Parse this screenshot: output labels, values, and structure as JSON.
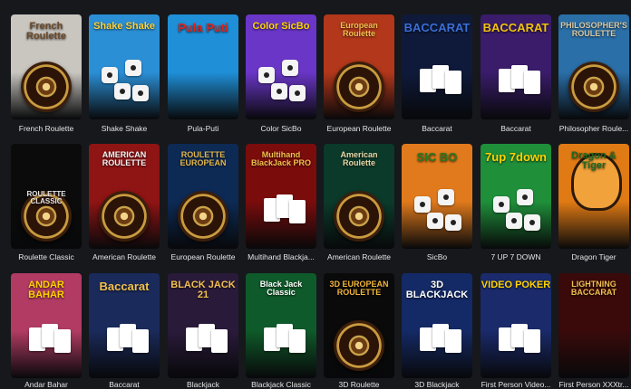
{
  "games": [
    {
      "id": "french-roulette",
      "title": "French Roulette",
      "art_text": "French Roulette",
      "bg": "#c9c6c0",
      "accent": "#6b4a2a"
    },
    {
      "id": "shake-shake",
      "title": "Shake Shake",
      "art_text": "Shake Shake",
      "bg": "#2b8fd6",
      "accent": "#ffd23a"
    },
    {
      "id": "pula-puti",
      "title": "Pula-Puti",
      "art_text": "Pula Puti",
      "bg": "#1f8fd8",
      "accent": "#e2231a"
    },
    {
      "id": "color-sicbo",
      "title": "Color SicBo",
      "art_text": "Color SicBo",
      "bg": "#6a36c8",
      "accent": "#ffd400"
    },
    {
      "id": "european-roulette-1",
      "title": "European Roulette",
      "art_text": "European Roulette",
      "bg": "#b2371b",
      "accent": "#f2c14e"
    },
    {
      "id": "baccarat-1",
      "title": "Baccarat",
      "art_text": "BACCARAT",
      "bg": "#0f1a3a",
      "accent": "#3a6fd8"
    },
    {
      "id": "baccarat-2",
      "title": "Baccarat",
      "art_text": "BACCARAT",
      "bg": "#3a1c6b",
      "accent": "#f1c40f"
    },
    {
      "id": "philosopher-roulette",
      "title": "Philosopher Roule...",
      "art_text": "PHILOSOPHER'S ROULETTE",
      "bg": "#2a6fa8",
      "accent": "#d9c9a3"
    },
    {
      "id": "roulette-classic",
      "title": "Roulette Classic",
      "art_text": "ROULETTE CLASSIC",
      "bg": "#0b0b0b",
      "accent": "#1f2a24"
    },
    {
      "id": "american-roulette-1",
      "title": "American Roulette",
      "art_text": "AMERICAN ROULETTE",
      "bg": "#8f1414",
      "accent": "#f5f5f5"
    },
    {
      "id": "european-roulette-2",
      "title": "European Roulette",
      "art_text": "ROULETTE EUROPEAN",
      "bg": "#0d2a55",
      "accent": "#e2b64a"
    },
    {
      "id": "multihand-blackjack",
      "title": "Multihand Blackja...",
      "art_text": "Multihand BlackJack PRO",
      "bg": "#7a0c0c",
      "accent": "#f2c14e"
    },
    {
      "id": "american-roulette-2",
      "title": "American Roulette",
      "art_text": "American Roulette",
      "bg": "#0b3a2a",
      "accent": "#e9d8a6"
    },
    {
      "id": "sicbo",
      "title": "SicBo",
      "art_text": "SIC BO",
      "bg": "#e07a1c",
      "accent": "#2b7a1f"
    },
    {
      "id": "7up-7down",
      "title": "7 UP 7 DOWN",
      "art_text": "7up 7down",
      "bg": "#1f8f3a",
      "accent": "#ffd400"
    },
    {
      "id": "dragon-tiger",
      "title": "Dragon Tiger",
      "art_text": "Dragon & Tiger",
      "bg": "#e07a14",
      "accent": "#1f6a1f"
    },
    {
      "id": "andar-bahar",
      "title": "Andar Bahar",
      "art_text": "ANDAR BAHAR",
      "bg": "#b13b63",
      "accent": "#ffd400"
    },
    {
      "id": "baccarat-3",
      "title": "Baccarat",
      "art_text": "Baccarat",
      "bg": "#1a2a5a",
      "accent": "#f2c14e"
    },
    {
      "id": "blackjack",
      "title": "Blackjack",
      "art_text": "BLACK JACK 21",
      "bg": "#2a1a3a",
      "accent": "#f2c14e"
    },
    {
      "id": "blackjack-classic",
      "title": "Blackjack Classic",
      "art_text": "Black Jack Classic",
      "bg": "#0f5a2a",
      "accent": "#ffffff"
    },
    {
      "id": "3d-european-roulette",
      "title": "3D Roulette",
      "art_text": "3D EUROPEAN ROULETTE",
      "bg": "#0a0a0a",
      "accent": "#f2b53a"
    },
    {
      "id": "3d-blackjack",
      "title": "3D Blackjack",
      "art_text": "3D BLACKJACK",
      "bg": "#142a66",
      "accent": "#ffffff"
    },
    {
      "id": "first-person-video-poker",
      "title": "First Person Video...",
      "art_text": "VIDEO POKER",
      "bg": "#1a2a6a",
      "accent": "#ffd400"
    },
    {
      "id": "first-person-xxxtreme",
      "title": "First Person XXXtr...",
      "art_text": "LIGHTNING BACCARAT",
      "bg": "#3a0a0a",
      "accent": "#f2c14e"
    }
  ]
}
